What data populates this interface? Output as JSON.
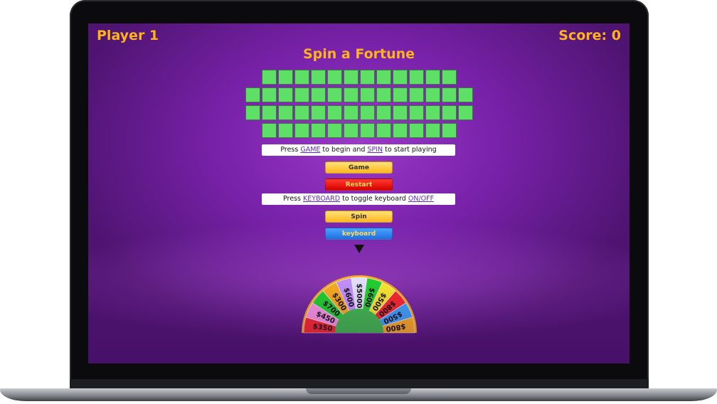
{
  "hud": {
    "player": "Player 1",
    "score": "Score: 0"
  },
  "title": "Spin a Fortune",
  "board": {
    "rows": [
      12,
      14,
      14,
      12
    ]
  },
  "instructions": {
    "game_prefix": "Press ",
    "game_link": "GAME",
    "game_mid": " to begin and ",
    "spin_link": "SPIN",
    "game_suffix": " to start playing",
    "kb_prefix": "Press ",
    "kb_link": "KEYBOARD",
    "kb_mid": " to toggle keyboard ",
    "kb_link2": "ON/OFF"
  },
  "buttons": {
    "game": "Game",
    "restart": "Restart",
    "spin": "Spin",
    "keyboard": "keyboard"
  },
  "wheel": {
    "segments": [
      {
        "label": "$350",
        "color": "#ff2a2a"
      },
      {
        "label": "$450",
        "color": "#ff9ae6"
      },
      {
        "label": "$700",
        "color": "#22d52e"
      },
      {
        "label": "$300",
        "color": "#ffb21c"
      },
      {
        "label": "$600",
        "color": "#c596ff"
      },
      {
        "label": "$5000",
        "color": "#e8e8ff"
      },
      {
        "label": "$600",
        "color": "#22d52e"
      },
      {
        "label": "$500",
        "color": "#ffef2a"
      },
      {
        "label": "$800",
        "color": "#ff2a2a"
      },
      {
        "label": "$500",
        "color": "#3fa7ff"
      },
      {
        "label": "$800",
        "color": "#ffb21c"
      }
    ],
    "hub_color": "#3fc24a",
    "rim_color": "#ffb21c"
  },
  "colors": {
    "accent": "#ffb21c",
    "tile": "#5ee067",
    "background": "#7a22ac"
  }
}
